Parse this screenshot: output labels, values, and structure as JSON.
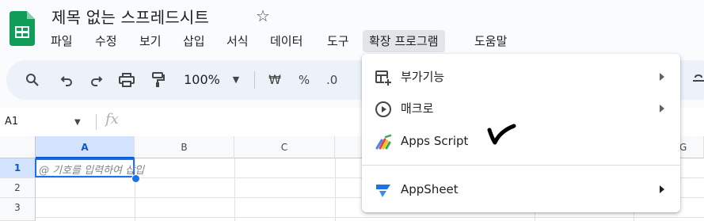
{
  "doc": {
    "title": "제목 없는 스프레드시트",
    "star_icon": "star-icon",
    "logo_icon": "sheets-logo-icon"
  },
  "menubar": {
    "items": [
      {
        "label": "파일"
      },
      {
        "label": "수정"
      },
      {
        "label": "보기"
      },
      {
        "label": "삽입"
      },
      {
        "label": "서식"
      },
      {
        "label": "데이터"
      },
      {
        "label": "도구"
      },
      {
        "label": "확장 프로그램"
      },
      {
        "label": "도움말"
      }
    ],
    "active_index": 7
  },
  "toolbar": {
    "zoom": "100%",
    "currency_label": "₩",
    "percent_label": "%",
    "decimal_label": ".0"
  },
  "formula_bar": {
    "cell_ref": "A1",
    "fx_label": "fx"
  },
  "grid": {
    "columns": [
      "A",
      "B",
      "C",
      "G"
    ],
    "rows": [
      "1",
      "2",
      "3"
    ],
    "active_cell_hint": "@ 기호를 입력하여 삽입"
  },
  "extensions_menu": {
    "items": [
      {
        "label": "부가기능",
        "icon": "addons-icon",
        "has_submenu": true
      },
      {
        "label": "매크로",
        "icon": "macro-play-icon",
        "has_submenu": true
      },
      {
        "label": "Apps Script",
        "icon": "apps-script-icon",
        "has_submenu": false
      },
      {
        "label": "AppSheet",
        "icon": "appsheet-icon",
        "has_submenu": true
      }
    ]
  },
  "colors": {
    "accent": "#1a73e8",
    "toolbar_bg": "#edf2fa",
    "active_menu_bg": "#e1e5ea",
    "sheets_green": "#0f9d58"
  }
}
